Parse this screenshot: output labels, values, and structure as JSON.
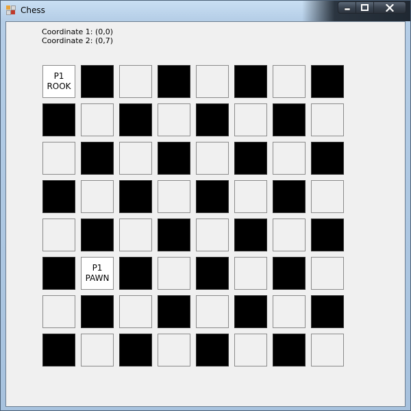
{
  "window": {
    "title": "Chess",
    "icon": "app-window-icon",
    "buttons": {
      "minimize_icon": "minimize-icon",
      "maximize_icon": "maximize-icon",
      "close_icon": "close-icon"
    }
  },
  "coordinates": {
    "line1": "Coordinate 1: (0,0)",
    "line2": "Coordinate 2: (0,7)"
  },
  "board": {
    "rows": 8,
    "cols": 8,
    "top_left_color": "light",
    "colors": {
      "dark": "#000000",
      "light": "#f0f0f0",
      "piece_bg": "#ffffff"
    },
    "pieces": [
      {
        "row": 0,
        "col": 0,
        "player": "P1",
        "name": "ROOK"
      },
      {
        "row": 5,
        "col": 1,
        "player": "P1",
        "name": "PAWN"
      }
    ]
  }
}
